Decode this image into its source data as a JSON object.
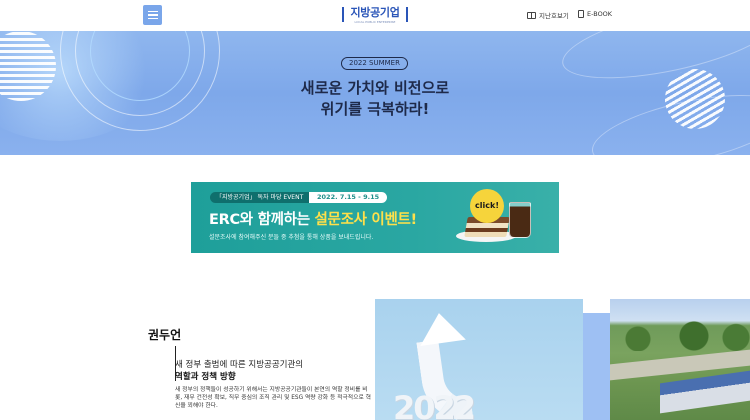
{
  "header": {
    "logo_title": "지방공기업",
    "logo_subtitle": "LOCAL PUBLIC ENTERPRISE",
    "links": [
      {
        "label": "지난호보기",
        "icon": "book-icon"
      },
      {
        "label": "E-BOOK",
        "icon": "ebook-icon"
      }
    ]
  },
  "hero": {
    "badge": "2022 SUMMER",
    "title_line1": "새로운 가치와 비전으로",
    "title_line2": "위기를 극복하라!"
  },
  "banner": {
    "tag": "「지방공기업」 독자 마당 EVENT",
    "date": "2022. 7.15 - 9.15",
    "headline_part1": "ERC와 함께하는 ",
    "headline_part2": "설문조사 이벤트!",
    "description": "설문조사에 참여해주신 분들 중 추첨을 통해 상품을 보내드립니다.",
    "click_label": "click!"
  },
  "article": {
    "title": "권두언",
    "subtitle_line1": "새 정부 출범에 따른 지방공공기관의",
    "subtitle_line2": "역할과 정책 방향",
    "body": "새 정부의 정책들이 성공하기 위해서는 지방공공기관들이 본연의 역할 정비를 비롯, 재무 건전성 확보, 직무 중심의 조직 관리 및 ESG 역량 강화 등 적극적으로 혁신을 꾀해야 한다."
  },
  "images": {
    "img1_year": "2022"
  },
  "colors": {
    "accent": "#2a55b8",
    "menu_button": "#7aa6ea",
    "hero_bg": "#8fb6ee",
    "banner_bg": "#1e9f9a",
    "highlight": "#ffe04a"
  }
}
